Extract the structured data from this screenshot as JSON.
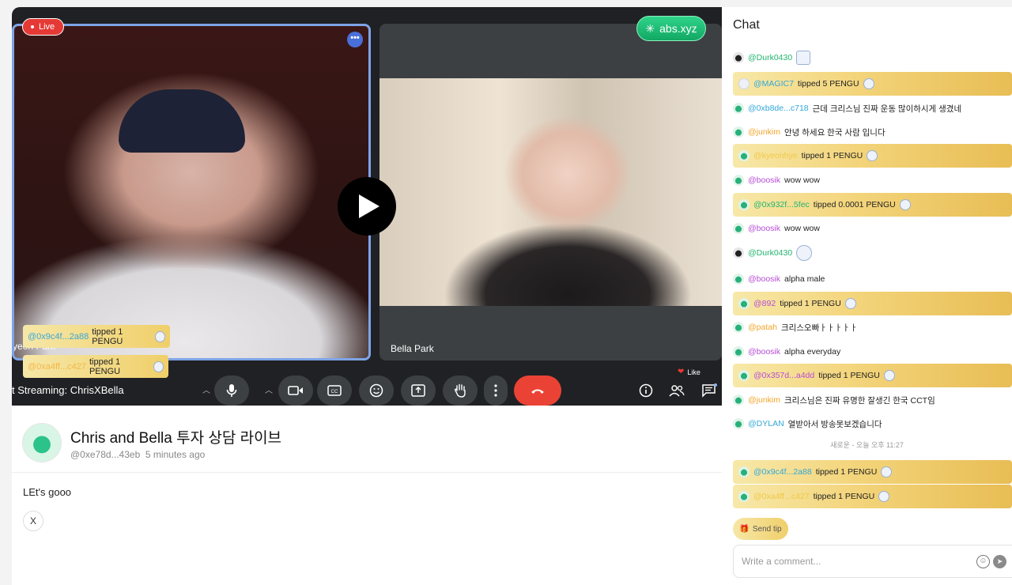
{
  "video": {
    "live_label": "Live",
    "brand_label": "abs.xyz",
    "left_name_partial": "yeon Park",
    "right_name": "Bella Park",
    "stream_title": "t Streaming: ChrisXBella",
    "like_label": "Like",
    "toasts": [
      {
        "user": "@0x9c4f...2a88",
        "text": "tipped 1 PENGU"
      },
      {
        "user": "@0xa4ff...c427",
        "text": "tipped 1 PENGU"
      }
    ]
  },
  "post": {
    "title": "Chris and Bella 투자 상담 라이브",
    "author": "@0xe78d...43eb",
    "time": "5 minutes ago",
    "body": "LEt's gooo",
    "share_icon": "X"
  },
  "chat": {
    "header": "Chat",
    "messages": [
      {
        "user": "@Durk0430",
        "text": "",
        "tip": false,
        "color": "#21b46f"
      },
      {
        "user": "@MAGIC7",
        "text": "tipped 5 PENGU",
        "tip": true,
        "color": "#31a7d9"
      },
      {
        "user": "@0xb8de...c718",
        "text": "근데 크리스님 진짜 운동 많이하시게 생겼네",
        "tip": false,
        "color": "#31a7d9"
      },
      {
        "user": "@junkim",
        "text": "안녕 하세요 한국 사람 입니다",
        "tip": false,
        "color": "#f2a52a"
      },
      {
        "user": "@kyeonhye",
        "text": "tipped 1 PENGU",
        "tip": true,
        "color": "#f0c84a"
      },
      {
        "user": "@boosik",
        "text": "wow wow",
        "tip": false,
        "color": "#b54bd6"
      },
      {
        "user": "@0x932f...5fec",
        "text": "tipped 0.0001 PENGU",
        "tip": true,
        "color": "#21b46f"
      },
      {
        "user": "@boosik",
        "text": "wow wow",
        "tip": false,
        "color": "#b54bd6"
      },
      {
        "user": "@Durk0430",
        "text": "",
        "tip": false,
        "color": "#21b46f"
      },
      {
        "user": "@boosik",
        "text": "alpha male",
        "tip": false,
        "color": "#b54bd6"
      },
      {
        "user": "@892",
        "text": "tipped 1 PENGU",
        "tip": true,
        "color": "#b54bd6"
      },
      {
        "user": "@patah",
        "text": "크리스오빠ㅏㅏㅏㅏㅏ",
        "tip": false,
        "color": "#f2a52a"
      },
      {
        "user": "@boosik",
        "text": "alpha everyday",
        "tip": false,
        "color": "#b54bd6"
      },
      {
        "user": "@0x357d...a4dd",
        "text": "tipped 1 PENGU",
        "tip": true,
        "color": "#b54bd6"
      },
      {
        "user": "@junkim",
        "text": "크리스님은 진짜 유명한 잘생긴 한국 CCT임",
        "tip": false,
        "color": "#f2a52a"
      },
      {
        "user": "@DYLAN",
        "text": "열받아서 방송못보겠습니다",
        "tip": false,
        "color": "#31a7d9"
      }
    ],
    "system_note": "새로운 - 오늘 오후 11:27",
    "new_messages": [
      {
        "user": "@0x9c4f...2a88",
        "text": "tipped 1 PENGU",
        "tip": true,
        "color": "#31a7d9"
      },
      {
        "user": "@0xa4ff...c427",
        "text": "tipped 1 PENGU",
        "tip": true,
        "color": "#f0c84a"
      }
    ],
    "send_tip_label": "Send tip",
    "comment_placeholder": "Write a comment..."
  }
}
